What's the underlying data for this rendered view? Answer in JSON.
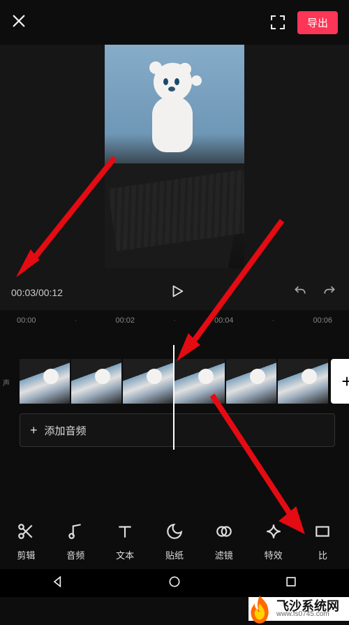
{
  "topbar": {
    "export_label": "导出"
  },
  "player": {
    "current_time": "00:03",
    "total_time": "00:12"
  },
  "ruler": {
    "marks": [
      "00:00",
      "·",
      "00:02",
      "·",
      "00:04",
      "·",
      "00:06"
    ]
  },
  "timeline": {
    "track_label": "声",
    "add_audio_label": "添加音频"
  },
  "toolbar": {
    "items": [
      {
        "id": "edit",
        "label": "剪辑",
        "icon": "scissors-icon"
      },
      {
        "id": "audio",
        "label": "音频",
        "icon": "music-note-icon"
      },
      {
        "id": "text",
        "label": "文本",
        "icon": "text-icon"
      },
      {
        "id": "sticker",
        "label": "贴纸",
        "icon": "moon-icon"
      },
      {
        "id": "filter",
        "label": "滤镜",
        "icon": "overlap-circles-icon"
      },
      {
        "id": "effect",
        "label": "特效",
        "icon": "star-icon"
      },
      {
        "id": "ratio",
        "label": "比",
        "icon": "ratio-icon"
      }
    ]
  },
  "watermark": {
    "title": "飞沙系统网",
    "url": "www.fs0745.com"
  }
}
